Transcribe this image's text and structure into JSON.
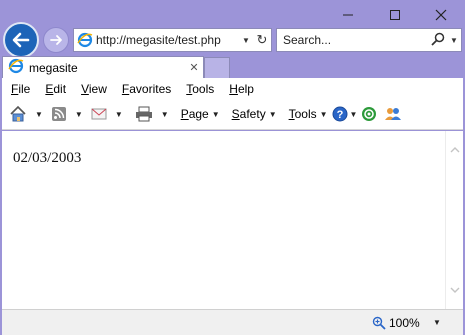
{
  "window": {
    "minimize_icon": "minimize-icon",
    "maximize_icon": "maximize-icon",
    "close_icon": "close-icon"
  },
  "nav": {
    "back_icon": "back-arrow-icon",
    "forward_icon": "forward-arrow-icon"
  },
  "address": {
    "url": "http://megasite/test.php"
  },
  "search": {
    "placeholder": "Search..."
  },
  "tabs": [
    {
      "label": "megasite"
    }
  ],
  "menu": {
    "items": [
      {
        "label": "File",
        "key": "F",
        "rest": "ile"
      },
      {
        "label": "Edit",
        "key": "E",
        "rest": "dit"
      },
      {
        "label": "View",
        "key": "V",
        "rest": "iew"
      },
      {
        "label": "Favorites",
        "key": "F",
        "rest": "avorites"
      },
      {
        "label": "Tools",
        "key": "T",
        "rest": "ools"
      },
      {
        "label": "Help",
        "key": "H",
        "rest": "elp"
      }
    ]
  },
  "commandbar": {
    "page_key": "P",
    "page_rest": "age",
    "safety_key": "S",
    "safety_rest": "afety",
    "tools_key": "T",
    "tools_rest": "ools"
  },
  "content": {
    "text": "02/03/2003"
  },
  "status": {
    "zoom": "100%"
  },
  "colors": {
    "frame": "#9c94d8",
    "back_button": "#1d64b8",
    "ie_logo": "#1e88e5"
  }
}
